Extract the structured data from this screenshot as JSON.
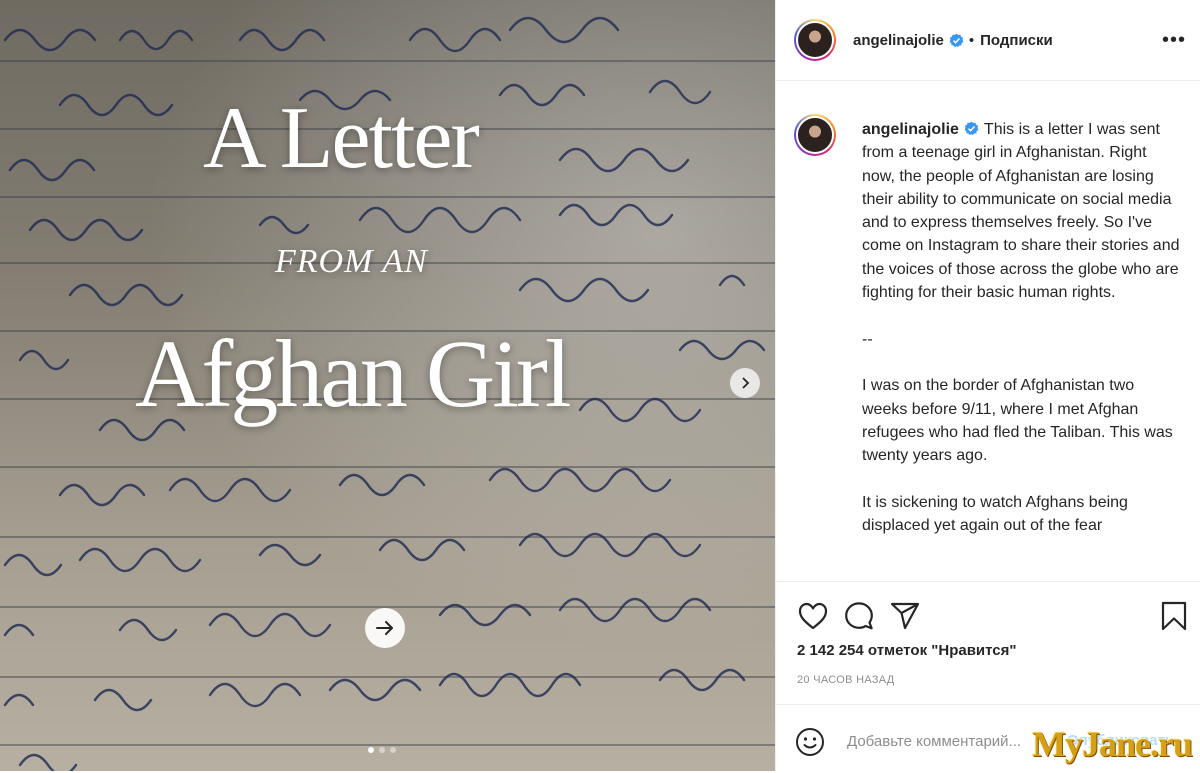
{
  "post": {
    "title_line1": "A Letter",
    "title_line2": "FROM AN",
    "title_line3": "Afghan Girl",
    "carousel_pages": 3,
    "carousel_active": 1
  },
  "header": {
    "username": "angelinajolie",
    "separator": "•",
    "follow_label": "Подписки",
    "more_label": "•••"
  },
  "caption": {
    "username": "angelinajolie",
    "paragraphs": [
      "This is a letter I was sent from a teenage girl in Afghanistan. Right now, the people of Afghanistan are losing their ability to communicate on social media and to express themselves freely. So I've come on Instagram to share their stories and the voices of those across the globe who are fighting for their basic human rights.",
      "--",
      "I was on the border of Afghanistan two weeks before 9/11, where I met Afghan refugees who had fled the Taliban. This was twenty years ago.",
      "It is sickening to watch Afghans being displaced yet again out of the fear"
    ]
  },
  "actions": {
    "likes": "2 142 254 отметок \"Нравится\"",
    "time": "20 ЧАСОВ НАЗАД"
  },
  "comment": {
    "placeholder": "Добавьте комментарий...",
    "post_label": "Опубликовать"
  },
  "watermark": "MyJane.ru",
  "icons": {
    "verified": "verified-badge-icon",
    "like": "heart-icon",
    "comment": "comment-bubble-icon",
    "share": "paper-plane-icon",
    "save": "bookmark-icon",
    "emoji": "smiley-icon",
    "next": "chevron-right-icon",
    "arrow": "arrow-right-icon"
  },
  "colors": {
    "verified": "#3897f0",
    "post_button": "#b2dffc",
    "muted": "#8e8e8e"
  }
}
